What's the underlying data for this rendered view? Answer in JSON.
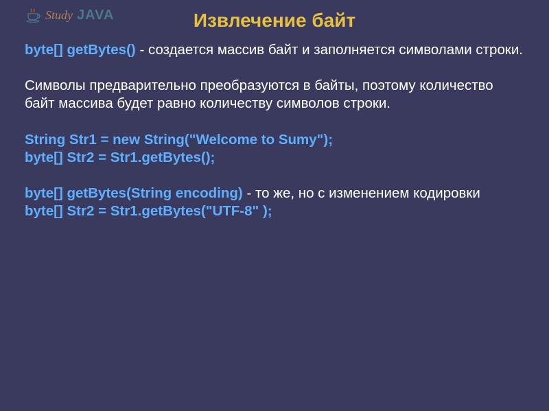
{
  "logo": {
    "study": "Study",
    "java": "JAVA"
  },
  "title": "Извлечение  байт",
  "line1": {
    "code": "byte[] getBytes()",
    "text": " - создается массив байт и заполняется символами строки."
  },
  "para2": "Символы предварительно преобразуются в байты, поэтому количество байт массива будет равно количеству символов строки.",
  "code_block1": {
    "l1": "String Str1 = new String(\"Welcome to Sumy\");",
    "l2": "byte[] Str2 = Str1.getBytes();"
  },
  "line3": {
    "code": "byte[] getBytes(String encoding)",
    "text": " - то же, но с изменением кодировки"
  },
  "code_block2": {
    "l1": "byte[] Str2 = Str1.getBytes(\"UTF-8\" );"
  }
}
